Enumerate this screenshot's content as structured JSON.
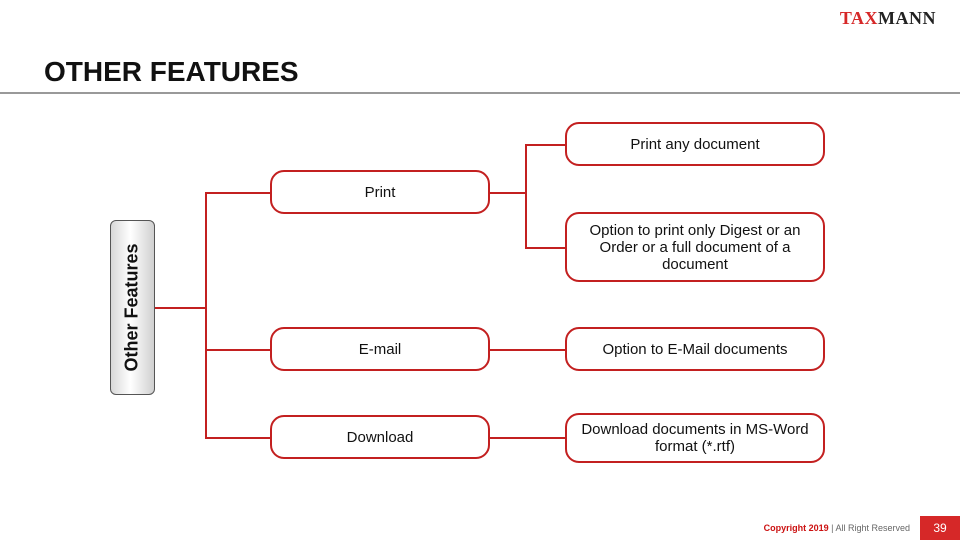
{
  "brand": {
    "part1": "TAX",
    "part2": "MANN"
  },
  "title": "OTHER FEATURES",
  "sidebar_label": "Other Features",
  "nodes": {
    "print": "Print",
    "email": "E-mail",
    "download": "Download",
    "print_any": "Print any document",
    "print_option": "Option to print only Digest or an Order or a full document of a document",
    "email_option": "Option to E-Mail documents",
    "download_option": "Download documents in MS-Word format (*.rtf)"
  },
  "footer": {
    "copyright_strong": "Copyright 2019",
    "copyright_rest": " | All Right Reserved",
    "page": "39"
  }
}
